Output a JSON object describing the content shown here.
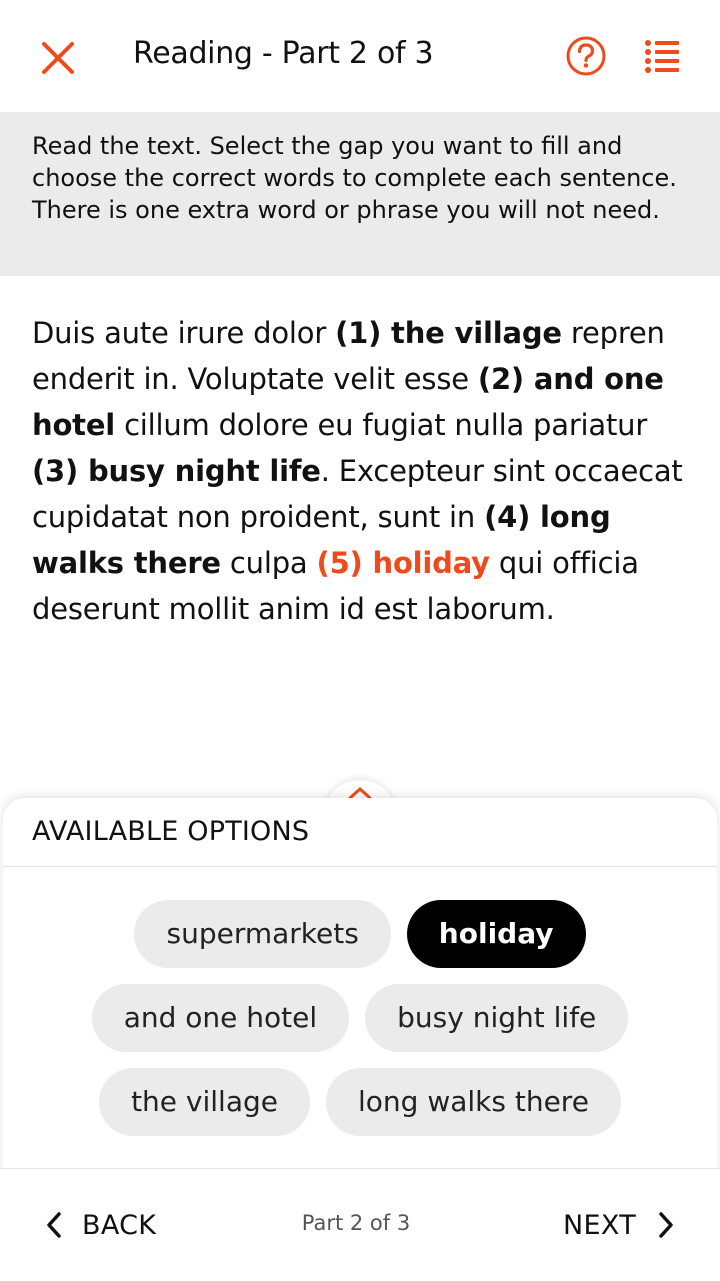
{
  "header": {
    "title": "Reading - Part 2 of 3",
    "icons": {
      "close": "close-icon",
      "help": "help-circle-icon",
      "list": "list-icon"
    },
    "accent_color": "#ee4a1c"
  },
  "instructions": {
    "text": "Read the text. Select the gap you want to fill and choose the correct words to complete each sentence. There is one extra word or phrase you will not need."
  },
  "passage": {
    "segments": {
      "t0": "Duis aute irure dolor ",
      "gap1": "(1) the village",
      "t1": " repren enderit in. Voluptate velit esse ",
      "gap2": "(2) and one hotel",
      "t2": " cillum dolore eu fugiat nulla pariatur ",
      "gap3": "(3) busy night life",
      "t3": ". Excepteur sint occaecat cupidatat non proident, sunt in ",
      "gap4": "(4) long walks there",
      "t4": " culpa ",
      "gap5": "(5) holiday",
      "t5": " qui officia deserunt mollit anim id est laborum."
    },
    "active_gap": 5
  },
  "options": {
    "title": "AVAILABLE OPTIONS",
    "toggle_icon": "expand-collapse-icon",
    "rows": [
      [
        {
          "label": "supermarkets",
          "selected": false
        },
        {
          "label": "holiday",
          "selected": true
        }
      ],
      [
        {
          "label": "and one hotel",
          "selected": false
        },
        {
          "label": "busy night life",
          "selected": false
        }
      ],
      [
        {
          "label": "the village",
          "selected": false
        },
        {
          "label": "long walks there",
          "selected": false
        }
      ]
    ]
  },
  "footer": {
    "back_label": "BACK",
    "next_label": "NEXT",
    "page_indicator": "Part 2 of 3",
    "icons": {
      "back": "chevron-left-icon",
      "next": "chevron-right-icon"
    }
  }
}
